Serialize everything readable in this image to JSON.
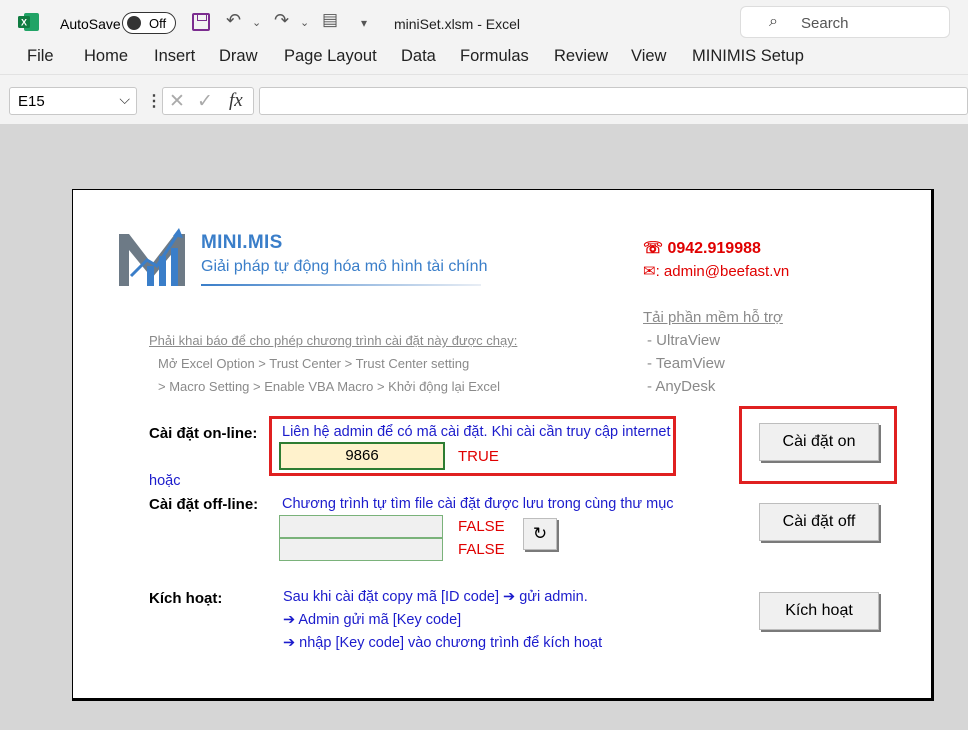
{
  "window": {
    "autosave_label": "AutoSave",
    "autosave_state": "Off",
    "title": "miniSet.xlsm  -  Excel",
    "search_placeholder": "Search"
  },
  "menu": [
    "File",
    "Home",
    "Insert",
    "Draw",
    "Page Layout",
    "Data",
    "Formulas",
    "Review",
    "View",
    "MINIMIS Setup"
  ],
  "formula_bar": {
    "cell_ref": "E15",
    "fx": "fx",
    "content": ""
  },
  "sheet": {
    "brand": "MINI.MIS",
    "tagline": "Giải pháp tự động hóa mô hình tài chính",
    "phone": "0942.919988",
    "email": ": admin@beefast.vn",
    "notes": [
      "Phải khai báo để cho phép chương trình cài đặt này được chạy:",
      "Mở Excel Option > Trust Center > Trust Center setting",
      "> Macro Setting > Enable VBA Macro > Khởi động lại Excel"
    ],
    "software_heading": "Tải phần mềm hỗ trợ",
    "software": [
      "- UltraView",
      "- TeamView",
      "- AnyDesk"
    ],
    "online_label": "Cài đặt on-line:",
    "online_desc": "Liên hệ admin để có mã cài đặt. Khi cài cần truy cập internet",
    "online_code": "9866",
    "online_status": "TRUE",
    "or_text": "hoặc",
    "offline_label": "Cài đặt off-line:",
    "offline_desc": "Chương trình tự tìm file cài đặt được lưu trong cùng thư mục",
    "offline_status_1": "FALSE",
    "offline_status_2": "FALSE",
    "activate_label": "Kích hoạt:",
    "activate_steps": [
      "Sau khi cài đặt copy mã [ID code] ➔ gửi admin.",
      "➔ Admin gửi mã [Key code]",
      "➔ nhập [Key code] vào chương trình để kích hoạt"
    ],
    "btn_online": "Cài đặt on",
    "btn_offline": "Cài đặt off",
    "btn_activate": "Kích hoạt",
    "refresh_icon": "↻"
  },
  "colors": {
    "brand_blue": "#3a7ec9",
    "alert_red": "#e00000",
    "link_blue": "#1c1ccc",
    "excel_green": "#2e7d32"
  }
}
